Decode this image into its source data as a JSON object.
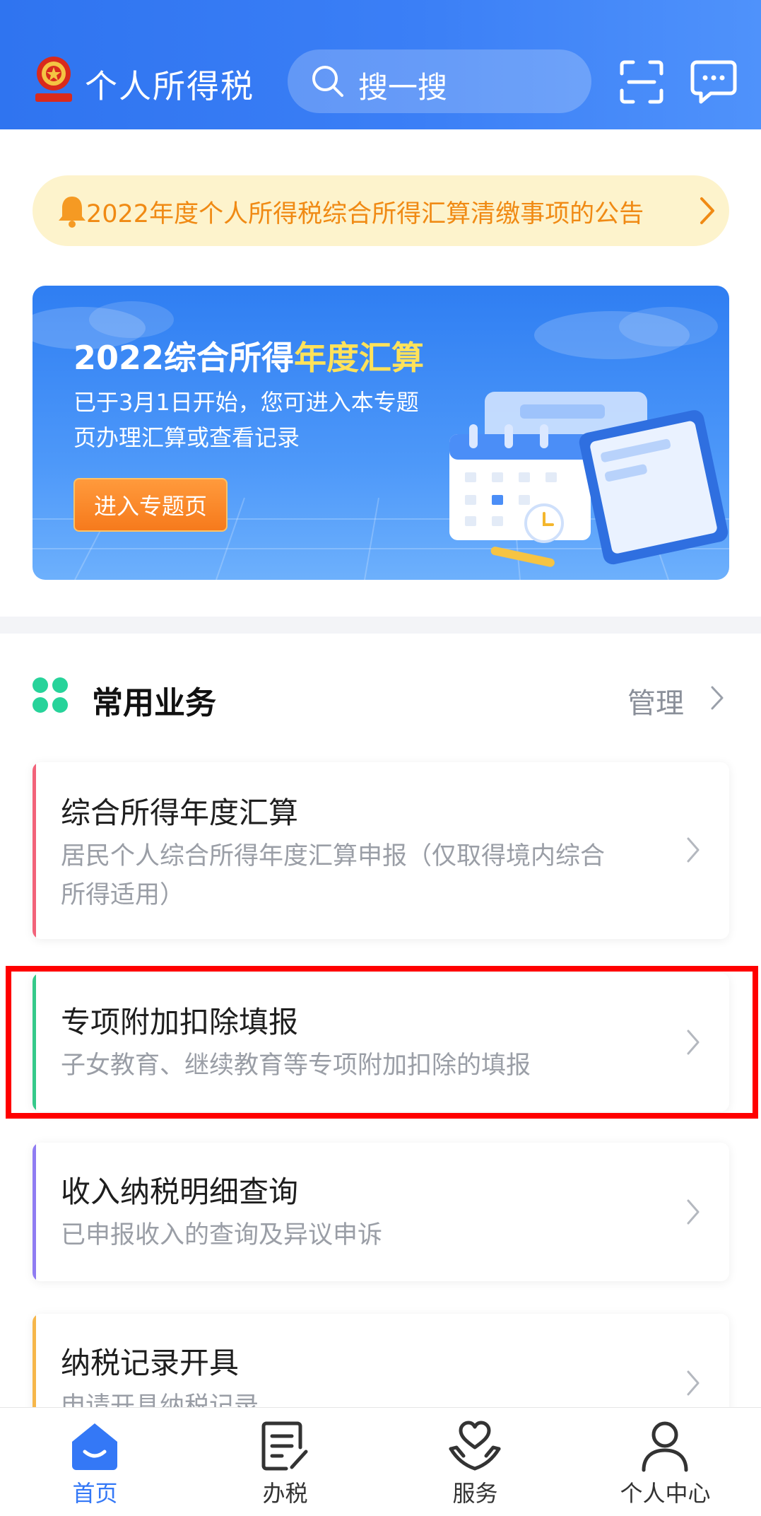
{
  "header": {
    "app_title": "个人所得税",
    "search_placeholder": "搜一搜",
    "icons": [
      "national-emblem-icon",
      "search-icon",
      "scan-icon",
      "message-icon"
    ]
  },
  "notice": {
    "text": "2022年度个人所得税综合所得汇算清缴事项的公告"
  },
  "banner": {
    "title_prefix": "2022综合所得",
    "title_highlight": "年度汇算",
    "desc_line1": "已于3月1日开始，您可进入本专题",
    "desc_line2": "页办理汇算或查看记录",
    "button_label": "进入专题页"
  },
  "section": {
    "title": "常用业务",
    "manage_label": "管理"
  },
  "cards": [
    {
      "title": "综合所得年度汇算",
      "desc_line1": "居民个人综合所得年度汇算申报（仅取得境内综合",
      "desc_line2": "所得适用）",
      "accent": "#f2637a"
    },
    {
      "title": "专项附加扣除填报",
      "desc_line1": "子女教育、继续教育等专项附加扣除的填报",
      "accent": "#35c98a"
    },
    {
      "title": "收入纳税明细查询",
      "desc_line1": "已申报收入的查询及异议申诉",
      "accent": "#8f7cf2"
    },
    {
      "title": "纳税记录开具",
      "desc_line1": "申请开具纳税记录",
      "accent": "#f6b64a"
    }
  ],
  "tabs": [
    {
      "label": "首页",
      "icon": "home-icon",
      "active": true
    },
    {
      "label": "办税",
      "icon": "document-edit-icon",
      "active": false
    },
    {
      "label": "服务",
      "icon": "heart-hands-icon",
      "active": false
    },
    {
      "label": "个人中心",
      "icon": "person-icon",
      "active": false
    }
  ],
  "colors": {
    "primary": "#3478f6",
    "notice_bg": "#fdf3cc",
    "notice_text": "#f08a14",
    "highlight_box": "#ff0000"
  }
}
